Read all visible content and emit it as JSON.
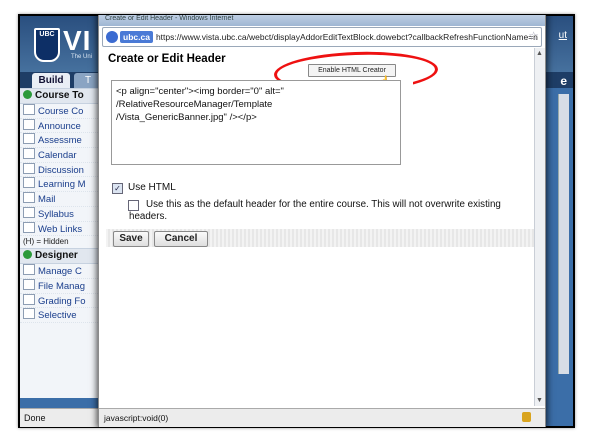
{
  "background": {
    "logo_text": "UBC",
    "app_letters": "VI",
    "app_subtitle": "The Uni",
    "tabs": [
      "Build",
      "T"
    ],
    "right_link": "ut",
    "right_letter": "e",
    "sections": [
      {
        "title": "Course To",
        "items": [
          "Course Co",
          "Announce",
          "Assessme",
          "Calendar",
          "Discussion",
          "Learning M",
          "Mail",
          "Syllabus",
          "Web Links"
        ]
      },
      {
        "title": "Designer",
        "items": [
          "Manage C",
          "File Manag",
          "Grading Fo",
          "Selective"
        ]
      }
    ],
    "hidden_note": "(H) = Hidden",
    "status": "Done"
  },
  "dialog": {
    "title_bar": "Create or Edit Header - Windows Internet",
    "address": {
      "domain": "ubc.ca",
      "url": "https://www.vista.ubc.ca/webct/displayAddorEditTextBlock.dowebct?callbackRefreshFunctionName=n"
    },
    "heading": "Create or Edit Header",
    "enable_button": "Enable HTML Creator",
    "editor_lines": [
      "<p align=\"center\"><img border=\"0\" alt=\"",
      "/RelativeResourceManager/Template",
      "/Vista_GenericBanner.jpg\" /></p>"
    ],
    "use_html_label": "Use HTML",
    "use_html_checked": true,
    "default_header_label": "Use this as the default header for the entire course. This will not overwrite existing headers.",
    "save_label": "Save",
    "cancel_label": "Cancel",
    "status_text": "javascript:void(0)"
  }
}
